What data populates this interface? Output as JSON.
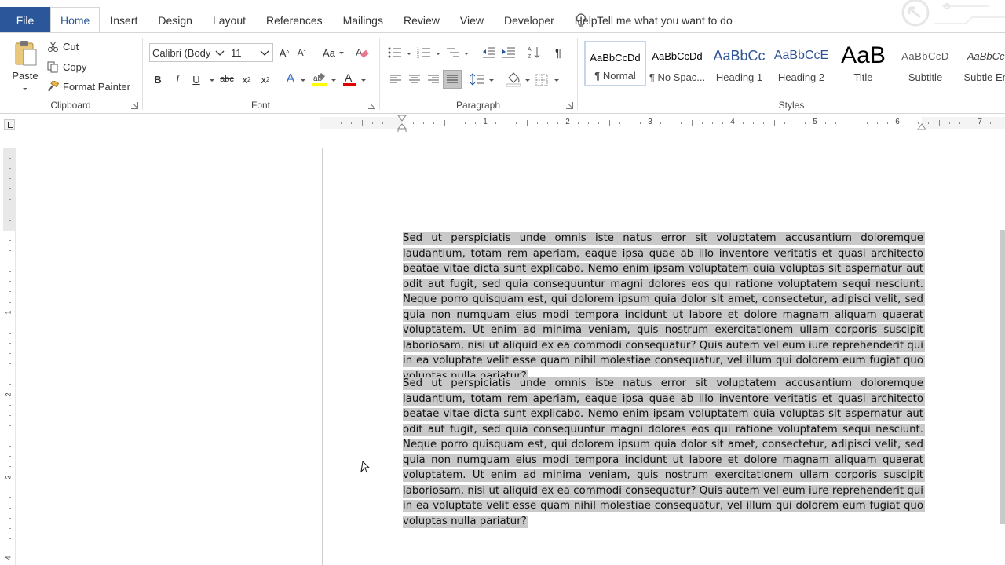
{
  "tabs": {
    "file": "File",
    "items": [
      "Home",
      "Insert",
      "Design",
      "Layout",
      "References",
      "Mailings",
      "Review",
      "View",
      "Developer",
      "Help"
    ],
    "active": "Home",
    "tell_me": "Tell me what you want to do"
  },
  "clipboard": {
    "paste": "Paste",
    "cut": "Cut",
    "copy": "Copy",
    "format_painter": "Format Painter",
    "label": "Clipboard"
  },
  "font": {
    "name": "Calibri (Body",
    "size": "11",
    "label": "Font"
  },
  "paragraph": {
    "label": "Paragraph"
  },
  "styles": {
    "label": "Styles",
    "items": [
      {
        "preview": "AaBbCcDd",
        "name": "¶ Normal"
      },
      {
        "preview": "AaBbCcDd",
        "name": "¶ No Spac..."
      },
      {
        "preview": "AaBbCc",
        "name": "Heading 1"
      },
      {
        "preview": "AaBbCcE",
        "name": "Heading 2"
      },
      {
        "preview": "AaB",
        "name": "Title"
      },
      {
        "preview": "AaBbCcD",
        "name": "Subtitle"
      },
      {
        "preview": "AaBbCcI",
        "name": "Subtle Em"
      }
    ]
  },
  "ruler": {
    "numbers": [
      "1",
      "2",
      "3",
      "4",
      "5",
      "6",
      "7"
    ],
    "vertical_numbers": [
      "1",
      "2",
      "3",
      "4"
    ]
  },
  "document": {
    "paragraphs": [
      "Sed ut perspiciatis unde omnis iste natus error sit voluptatem accusantium doloremque laudantium, totam rem aperiam, eaque ipsa quae ab illo inventore veritatis et quasi architecto beatae vitae dicta sunt explicabo. Nemo enim ipsam voluptatem quia voluptas sit aspernatur aut odit aut fugit, sed quia consequuntur magni dolores eos qui ratione voluptatem sequi nesciunt. Neque porro quisquam est, qui dolorem ipsum quia dolor sit amet, consectetur, adipisci velit, sed quia non numquam eius modi tempora incidunt ut labore et dolore magnam aliquam quaerat voluptatem. Ut enim ad minima veniam, quis nostrum exercitationem ullam corporis suscipit laboriosam, nisi ut aliquid ex ea commodi consequatur? Quis autem vel eum iure reprehenderit qui in ea voluptate velit esse quam nihil molestiae consequatur, vel illum qui dolorem eum fugiat quo voluptas nulla pariatur?",
      "Sed ut perspiciatis unde omnis iste natus error sit voluptatem accusantium doloremque laudantium, totam rem aperiam, eaque ipsa quae ab illo inventore veritatis et quasi architecto beatae vitae dicta sunt explicabo. Nemo enim ipsam voluptatem quia voluptas sit aspernatur aut odit aut fugit, sed quia consequuntur magni dolores eos qui ratione voluptatem sequi nesciunt. Neque porro quisquam est, qui dolorem ipsum quia dolor sit amet, consectetur, adipisci velit, sed quia non numquam eius modi tempora incidunt ut labore et dolore magnam aliquam quaerat voluptatem. Ut enim ad minima veniam, quis nostrum exercitationem ullam corporis suscipit laboriosam, nisi ut aliquid ex ea commodi consequatur? Quis autem vel eum iure reprehenderit qui in ea voluptate velit esse quam nihil molestiae consequatur, vel illum qui dolorem eum fugiat quo voluptas nulla pariatur?"
    ]
  },
  "colors": {
    "file_tab": "#2b579a",
    "highlight_yellow": "#ffff00",
    "font_color_red": "#e00000",
    "selection": "#c9c9c9"
  }
}
